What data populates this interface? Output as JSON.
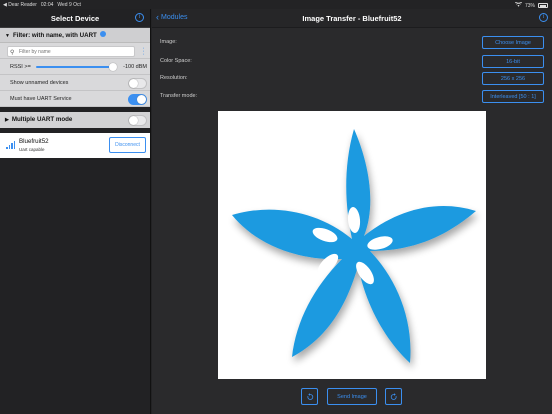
{
  "status_bar": {
    "back_app": "◀ Dear Reader",
    "time": "02:04",
    "date": "Wed 9 Oct",
    "battery": "73%"
  },
  "left_panel": {
    "title": "Select Device",
    "filter": {
      "title": "Filter: with name, with UART",
      "search_placeholder": "Filter by name",
      "rssi_label": "RSSI >=",
      "rssi_value": "-100 dBM",
      "show_unnamed_label": "Show unnamed devices",
      "show_unnamed_on": false,
      "must_have_uart_label": "Must have UART Service",
      "must_have_uart_on": true
    },
    "multi_uart": {
      "label": "Multiple UART mode",
      "on": false
    },
    "device": {
      "name": "Bluefruit52",
      "subtitle": "Uart capable",
      "disconnect_label": "Disconnect"
    }
  },
  "right_panel": {
    "back_label": "Modules",
    "title": "Image Transfer - Bluefruit52",
    "params": [
      {
        "label": "Image:",
        "button": "Choose Image"
      },
      {
        "label": "Color Space:",
        "button": "16-bit"
      },
      {
        "label": "Resolution:",
        "button": "256 x 256"
      },
      {
        "label": "Transfer mode:",
        "button": "Interleaved [50 : 1]"
      }
    ],
    "send_label": "Send Image"
  },
  "colors": {
    "accent": "#3b8ff0",
    "flower": "#1f9ae0"
  }
}
